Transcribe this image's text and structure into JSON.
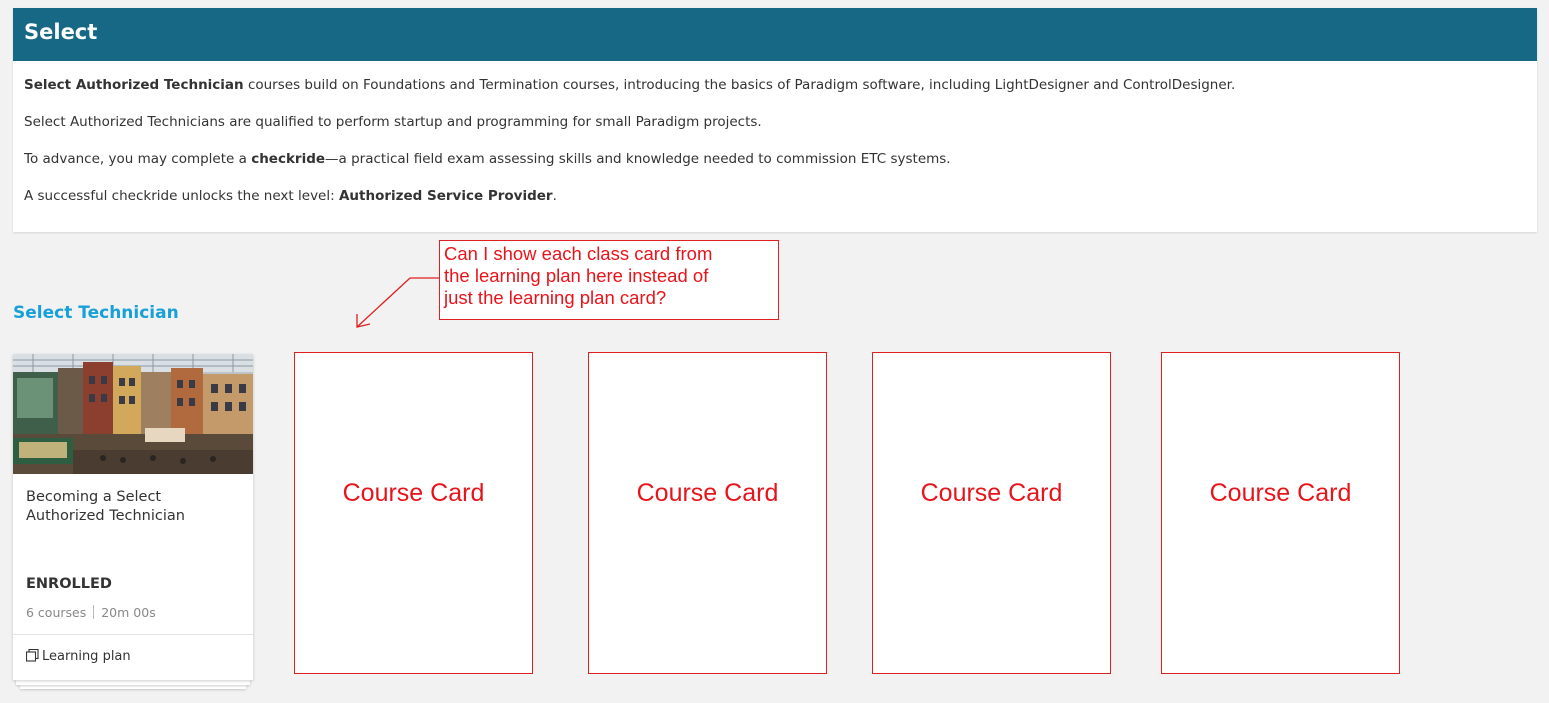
{
  "panel": {
    "title": "Select",
    "paragraphs": [
      {
        "bold": "Select Authorized Technician",
        "rest": " courses build on Foundations and Termination courses, introducing the basics of Paradigm software, including LightDesigner and ControlDesigner."
      },
      {
        "text": "Select Authorized Technicians are qualified to perform startup and programming for small Paradigm projects."
      },
      {
        "pre": "To advance, you may complete a ",
        "bold": "checkride",
        "post": "—a practical field exam assessing skills and knowledge needed to commission ETC systems."
      },
      {
        "pre": "A successful checkride unlocks the next level: ",
        "bold": "Authorized Service Provider",
        "post": "."
      }
    ]
  },
  "annotation": {
    "lines": [
      "Can I show each class card from",
      "the learning plan here instead of",
      "just the learning plan card?"
    ],
    "color": "#e8141b"
  },
  "section": {
    "title": "Select Technician"
  },
  "learning_plan_card": {
    "title": "Becoming a Select Authorized Technician",
    "status": "ENROLLED",
    "courses": "6 courses",
    "duration": "20m 00s",
    "type_label": "Learning plan",
    "type_icon": "learning-plan-icon"
  },
  "course_cards": [
    {
      "label": "Course Card"
    },
    {
      "label": "Course Card"
    },
    {
      "label": "Course Card"
    },
    {
      "label": "Course Card"
    }
  ],
  "colors": {
    "header": "#166885",
    "section_title": "#1aa0d8",
    "annotation": "#e02020"
  }
}
